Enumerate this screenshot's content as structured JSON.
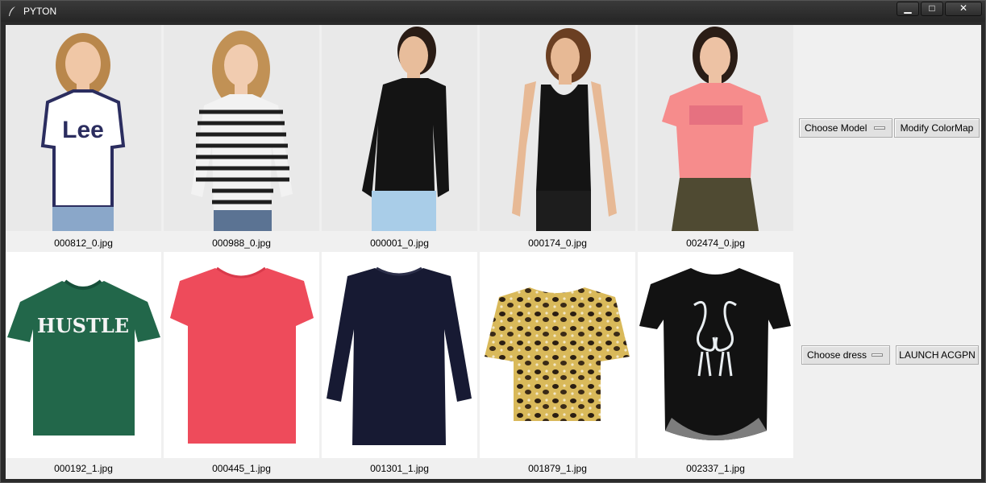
{
  "window": {
    "title": "PYTON",
    "controls": {
      "minimize": "▁",
      "maximize": "□",
      "close": "✕"
    }
  },
  "models": [
    {
      "filename": "000812_0.jpg",
      "top_color": "#ffffff",
      "logo": "Lee"
    },
    {
      "filename": "000988_0.jpg",
      "top_color": "#f2f2f2"
    },
    {
      "filename": "000001_0.jpg",
      "top_color": "#141414"
    },
    {
      "filename": "000174_0.jpg",
      "top_color": "#141414"
    },
    {
      "filename": "002474_0.jpg",
      "top_color": "#f68c8c"
    }
  ],
  "dresses": [
    {
      "filename": "000192_1.jpg",
      "color": "#22674a",
      "print": "HUSTLE"
    },
    {
      "filename": "000445_1.jpg",
      "color": "#ee4b5b"
    },
    {
      "filename": "001301_1.jpg",
      "color": "#171a33"
    },
    {
      "filename": "001879_1.jpg",
      "color": "#c9a647"
    },
    {
      "filename": "002337_1.jpg",
      "color": "#121212"
    }
  ],
  "controls": {
    "choose_model": "Choose Model",
    "modify_colormap": "Modify ColorMap",
    "choose_dress": "Choose dress",
    "launch": "LAUNCH ACGPN"
  }
}
